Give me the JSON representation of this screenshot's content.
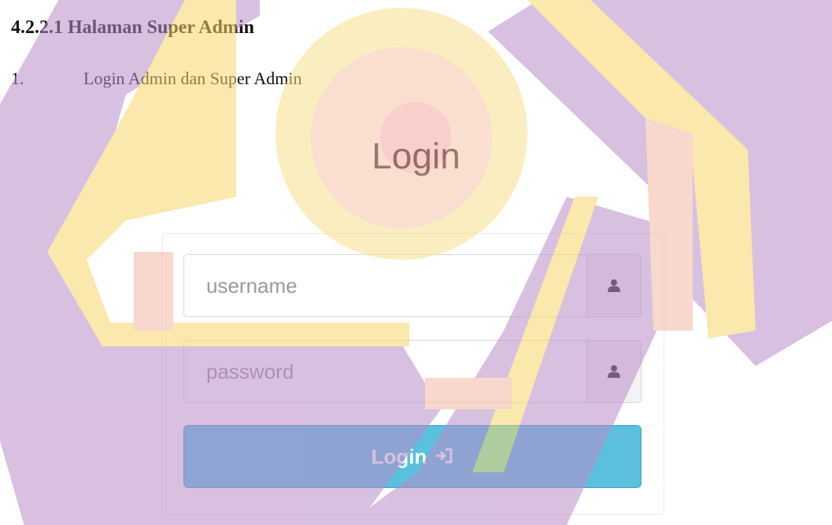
{
  "document": {
    "heading": "4.2.2.1 Halaman Super Admin",
    "list_item": {
      "number": "1.",
      "text": "Login Admin dan Super Admin"
    }
  },
  "login_form": {
    "title": "Login",
    "username_placeholder": "username",
    "password_placeholder": "password",
    "username_icon": "user-icon",
    "password_icon": "user-icon",
    "button_label": "Login",
    "button_icon": "sign-in-icon",
    "button_color": "#5ac0de"
  },
  "watermark": {
    "colors": [
      "#c9a6d4",
      "#f7e08c",
      "#f6c4b8"
    ]
  }
}
